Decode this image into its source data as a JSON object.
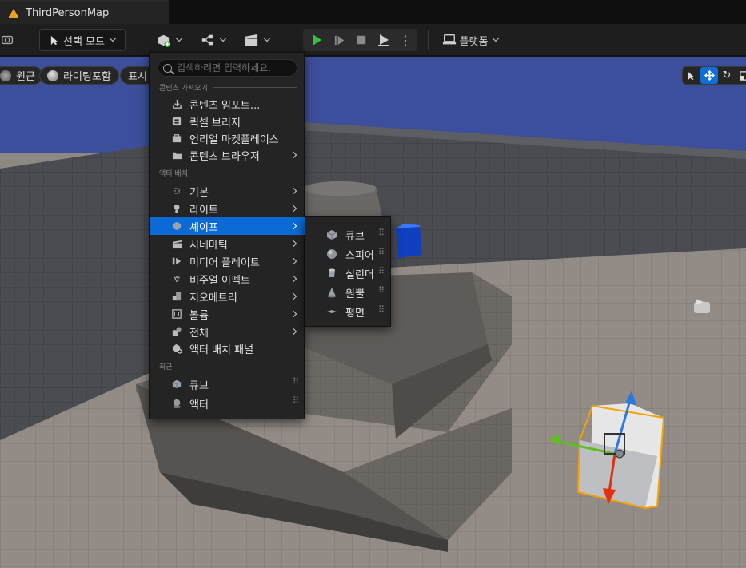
{
  "window": {
    "tab_title": "ThirdPersonMap"
  },
  "toolbar": {
    "select_mode_label": "선택 모드",
    "platform_label": "플랫폼"
  },
  "viewport": {
    "perspective_label": "원근",
    "lighting_label": "라이팅포함",
    "show_label": "표시"
  },
  "quick_add_menu": {
    "search_placeholder": "검색하려면 입력하세요.",
    "section_content": "콘텐츠 가져오기",
    "section_place": "액터 배치",
    "section_recent": "최근",
    "content_items": [
      {
        "label": "콘텐츠 임포트...",
        "icon": "import-icon"
      },
      {
        "label": "퀵셀 브리지",
        "icon": "bridge-icon"
      },
      {
        "label": "언리얼 마켓플레이스",
        "icon": "marketplace-icon"
      },
      {
        "label": "콘텐츠 브라우저",
        "icon": "folder-icon",
        "has_submenu": true
      }
    ],
    "place_items": [
      {
        "label": "기본",
        "icon": "basic-icon",
        "has_submenu": true
      },
      {
        "label": "라이트",
        "icon": "light-icon",
        "has_submenu": true
      },
      {
        "label": "셰이프",
        "icon": "shape-icon",
        "has_submenu": true,
        "highlighted": true
      },
      {
        "label": "시네마틱",
        "icon": "cinematic-icon",
        "has_submenu": true
      },
      {
        "label": "미디어 플레이트",
        "icon": "media-icon",
        "has_submenu": true
      },
      {
        "label": "비주얼 이펙트",
        "icon": "vfx-icon",
        "has_submenu": true
      },
      {
        "label": "지오메트리",
        "icon": "geometry-icon",
        "has_submenu": true
      },
      {
        "label": "볼륨",
        "icon": "volume-icon",
        "has_submenu": true
      },
      {
        "label": "전체",
        "icon": "all-icon",
        "has_submenu": true
      },
      {
        "label": "액터 배치 패널",
        "icon": "place-panel-icon"
      }
    ],
    "recent_items": [
      {
        "label": "큐브",
        "icon": "cube-icon"
      },
      {
        "label": "액터",
        "icon": "actor-icon"
      }
    ]
  },
  "shapes_submenu": {
    "items": [
      {
        "label": "큐브",
        "icon": "cube-icon"
      },
      {
        "label": "스피어",
        "icon": "sphere-icon"
      },
      {
        "label": "실린더",
        "icon": "cylinder-icon"
      },
      {
        "label": "원뿔",
        "icon": "cone-icon"
      },
      {
        "label": "평면",
        "icon": "plane-icon"
      }
    ]
  },
  "colors": {
    "accent": "#0b6ad6",
    "play_green": "#3fbf3f",
    "annotation_red": "#e01010",
    "sky": "#3c4f9c"
  }
}
